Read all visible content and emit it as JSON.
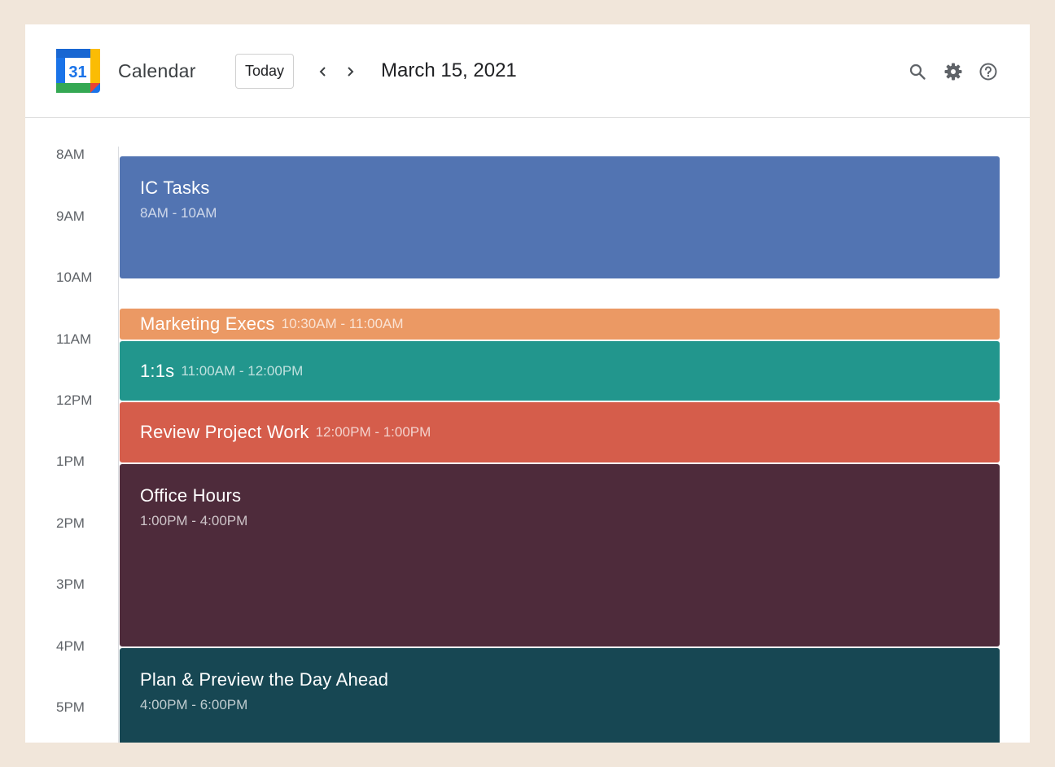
{
  "header": {
    "logo_text": "31",
    "app_title": "Calendar",
    "today_label": "Today",
    "prev_icon": "chevron-left-icon",
    "next_icon": "chevron-right-icon",
    "date_title": "March 15, 2021",
    "search_icon": "search-icon",
    "settings_icon": "gear-icon",
    "help_icon": "help-icon"
  },
  "time_labels": [
    "8AM",
    "9AM",
    "10AM",
    "11AM",
    "12PM",
    "1PM",
    "2PM",
    "3PM",
    "4PM",
    "5PM"
  ],
  "events": [
    {
      "title": "IC Tasks",
      "time": "8AM - 10AM",
      "color": "#5274b2"
    },
    {
      "title": "Marketing Execs",
      "time": "10:30AM - 11:00AM",
      "color": "#eb9964"
    },
    {
      "title": "1:1s",
      "time": "11:00AM - 12:00PM",
      "color": "#22968d"
    },
    {
      "title": "Review Project Work",
      "time": "12:00PM - 1:00PM",
      "color": "#d55d4b"
    },
    {
      "title": "Office Hours",
      "time": "1:00PM - 4:00PM",
      "color": "#4e2b3b"
    },
    {
      "title": "Plan & Preview the Day Ahead",
      "time": "4:00PM - 6:00PM",
      "color": "#174753"
    }
  ]
}
